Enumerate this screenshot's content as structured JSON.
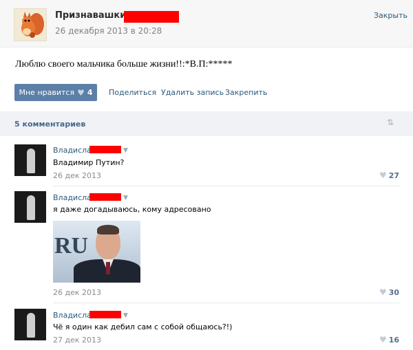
{
  "header": {
    "group_name": "Признавашки",
    "post_date": "26 декабря 2013 в 20:28",
    "close_label": "Закрыть"
  },
  "post": {
    "text": "Люблю своего мальчика больше жизни!!:*В.П:*****"
  },
  "actions": {
    "like_label": "Мне нравится",
    "like_count": "4",
    "share_label": "Поделиться",
    "delete_label": "Удалить запись",
    "pin_label": "Закрепить"
  },
  "comments_header": {
    "count_label": "5 комментариев"
  },
  "comments": [
    {
      "author": "Владислав",
      "text": "Владимир Путин?",
      "date": "26 дек 2013",
      "likes": "27"
    },
    {
      "author": "Владислав",
      "text": "я даже догадываюсь, кому адресовано",
      "image_caption": "RU",
      "date": "26 дек 2013",
      "likes": "30"
    },
    {
      "author": "Владислав",
      "text": "Чё я один как дебил сам с собой общаюсь?!)",
      "date": "27 дек 2013",
      "likes": "16"
    }
  ],
  "icons": {
    "heart": "heart-icon",
    "caret": "caret-down-icon",
    "sort": "sort-arrows-icon"
  },
  "colors": {
    "link": "#2b587a",
    "like_button": "#5b7fa6",
    "redaction": "#ff0000"
  }
}
